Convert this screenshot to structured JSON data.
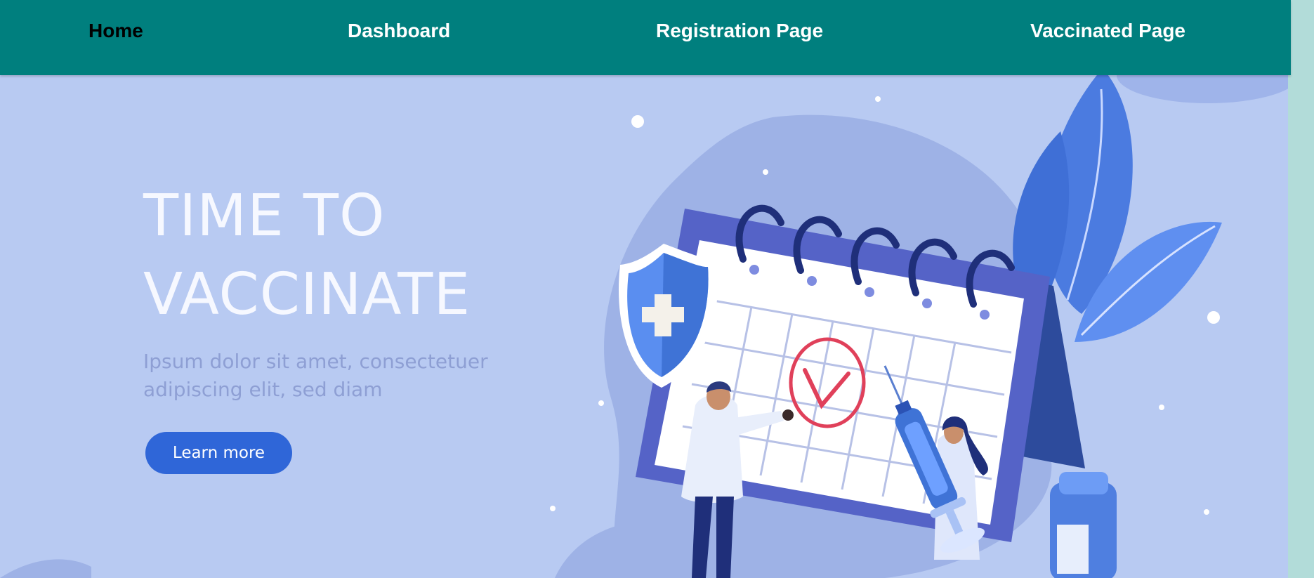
{
  "nav": {
    "items": [
      {
        "label": "Home",
        "active": true
      },
      {
        "label": "Dashboard",
        "active": false
      },
      {
        "label": "Registration Page",
        "active": false
      },
      {
        "label": "Vaccinated Page",
        "active": false
      }
    ]
  },
  "hero": {
    "title_line1": "TIME TO",
    "title_line2": "VACCINATE",
    "subtitle_line1": "Ipsum dolor sit amet, consectetuer",
    "subtitle_line2": "adipiscing elit, sed diam",
    "button_label": "Learn more"
  },
  "colors": {
    "nav_bg": "#007f7e",
    "hero_bg": "#b8caf2",
    "button_bg": "#2f66d8",
    "checkmark": "#e0405a"
  }
}
